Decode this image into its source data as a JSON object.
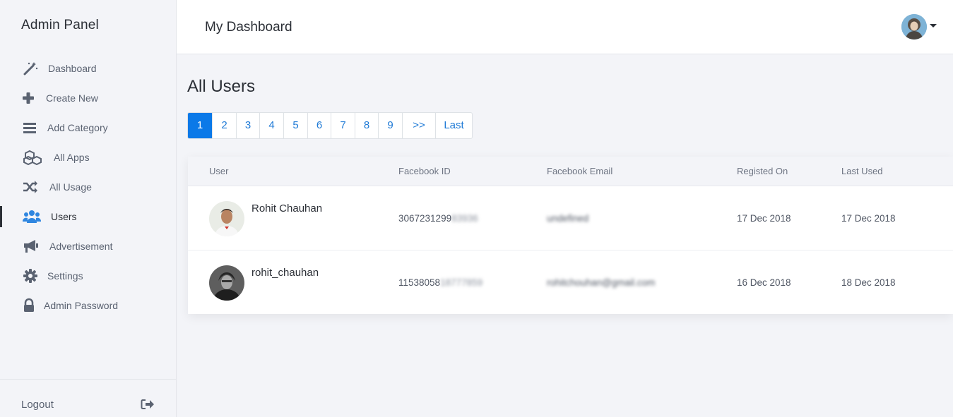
{
  "sidebar": {
    "brand": "Admin Panel",
    "items": [
      {
        "label": "Dashboard",
        "icon": "magic-wand-icon"
      },
      {
        "label": "Create New",
        "icon": "plus-icon"
      },
      {
        "label": "Add Category",
        "icon": "bars-icon"
      },
      {
        "label": "All Apps",
        "icon": "cubes-icon"
      },
      {
        "label": "All Usage",
        "icon": "random-icon"
      },
      {
        "label": "Users",
        "icon": "users-icon",
        "active": true
      },
      {
        "label": "Advertisement",
        "icon": "bullhorn-icon"
      },
      {
        "label": "Settings",
        "icon": "gear-icon"
      },
      {
        "label": "Admin Password",
        "icon": "lock-icon"
      }
    ],
    "logout": "Logout"
  },
  "header": {
    "title": "My Dashboard"
  },
  "main": {
    "title": "All Users",
    "pagination": [
      "1",
      "2",
      "3",
      "4",
      "5",
      "6",
      "7",
      "8",
      "9",
      ">>",
      "Last"
    ],
    "active_page": "1",
    "table": {
      "columns": [
        "User",
        "Facebook ID",
        "Facebook Email",
        "Registed On",
        "Last Used"
      ],
      "rows": [
        {
          "user": "Rohit Chauhan",
          "fb_id": "3067231299",
          "fb_id_hidden": "83936",
          "email_hidden": "undefined",
          "registered": "17 Dec 2018",
          "last_used": "17 Dec 2018"
        },
        {
          "user": "rohit_chauhan",
          "fb_id": "11538058",
          "fb_id_hidden": "18777859",
          "email_hidden": "rohitchouhan@gmail.com",
          "registered": "16 Dec 2018",
          "last_used": "18 Dec 2018"
        }
      ]
    }
  },
  "colors": {
    "accent": "#0b79e8",
    "link": "#1f7ad6",
    "users_icon": "#2f86e0",
    "icon": "#5a6271"
  }
}
